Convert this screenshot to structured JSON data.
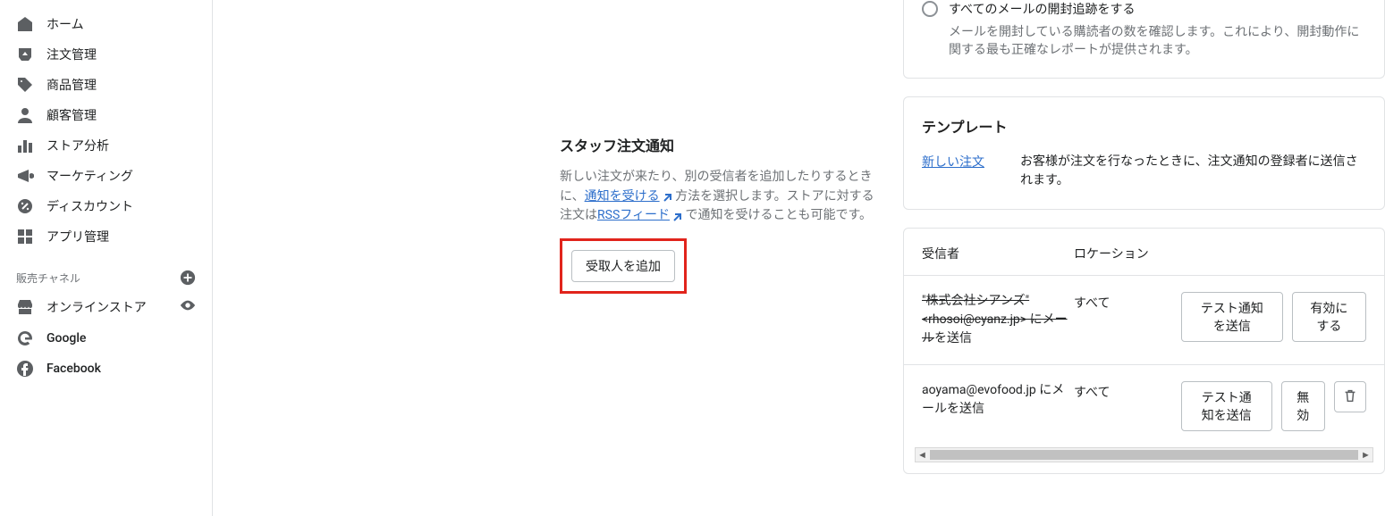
{
  "sidebar": {
    "items": [
      {
        "label": "ホーム",
        "icon": "home-icon"
      },
      {
        "label": "注文管理",
        "icon": "inbox-icon"
      },
      {
        "label": "商品管理",
        "icon": "tag-icon"
      },
      {
        "label": "顧客管理",
        "icon": "user-icon"
      },
      {
        "label": "ストア分析",
        "icon": "analytics-icon"
      },
      {
        "label": "マーケティング",
        "icon": "megaphone-icon"
      },
      {
        "label": "ディスカウント",
        "icon": "discount-icon"
      },
      {
        "label": "アプリ管理",
        "icon": "apps-icon"
      }
    ],
    "channels_header": "販売チャネル",
    "channels": [
      {
        "label": "オンラインストア",
        "icon": "store-icon",
        "right_icon": "eye-icon"
      },
      {
        "label": "Google",
        "icon": "google-icon"
      },
      {
        "label": "Facebook",
        "icon": "facebook-icon"
      }
    ]
  },
  "tracking": {
    "label": "すべてのメールの開封追跡をする",
    "desc": "メールを開封している購読者の数を確認します。これにより、開封動作に関する最も正確なレポートが提供されます。"
  },
  "staff_notify": {
    "title": "スタッフ注文通知",
    "desc_pre": "新しい注文が来たり、別の受信者を追加したりするときに、",
    "link1": "通知を受ける",
    "desc_mid": " 方法を選択します。ストアに対する注文は",
    "link2": "RSSフィード",
    "desc_post": " で通知を受けることも可能です。",
    "add_button": "受取人を追加"
  },
  "template": {
    "title": "テンプレート",
    "link": "新しい注文",
    "desc": "お客様が注文を行なったときに、注文通知の登録者に送信されます。"
  },
  "recipients": {
    "col1": "受信者",
    "col2": "ロケーション",
    "rows": [
      {
        "text_strike": "\"株式会社シアンズ\" <rhosoi@cyanz.jp> にメール",
        "text_plain": "を送信",
        "location": "すべて",
        "send_test": "テスト通知を送信",
        "enable": "有効にする"
      },
      {
        "text": "aoyama@evofood.jp にメールを送信",
        "location": "すべて",
        "send_test": "テスト通知を送信",
        "disable": "無効"
      }
    ]
  }
}
